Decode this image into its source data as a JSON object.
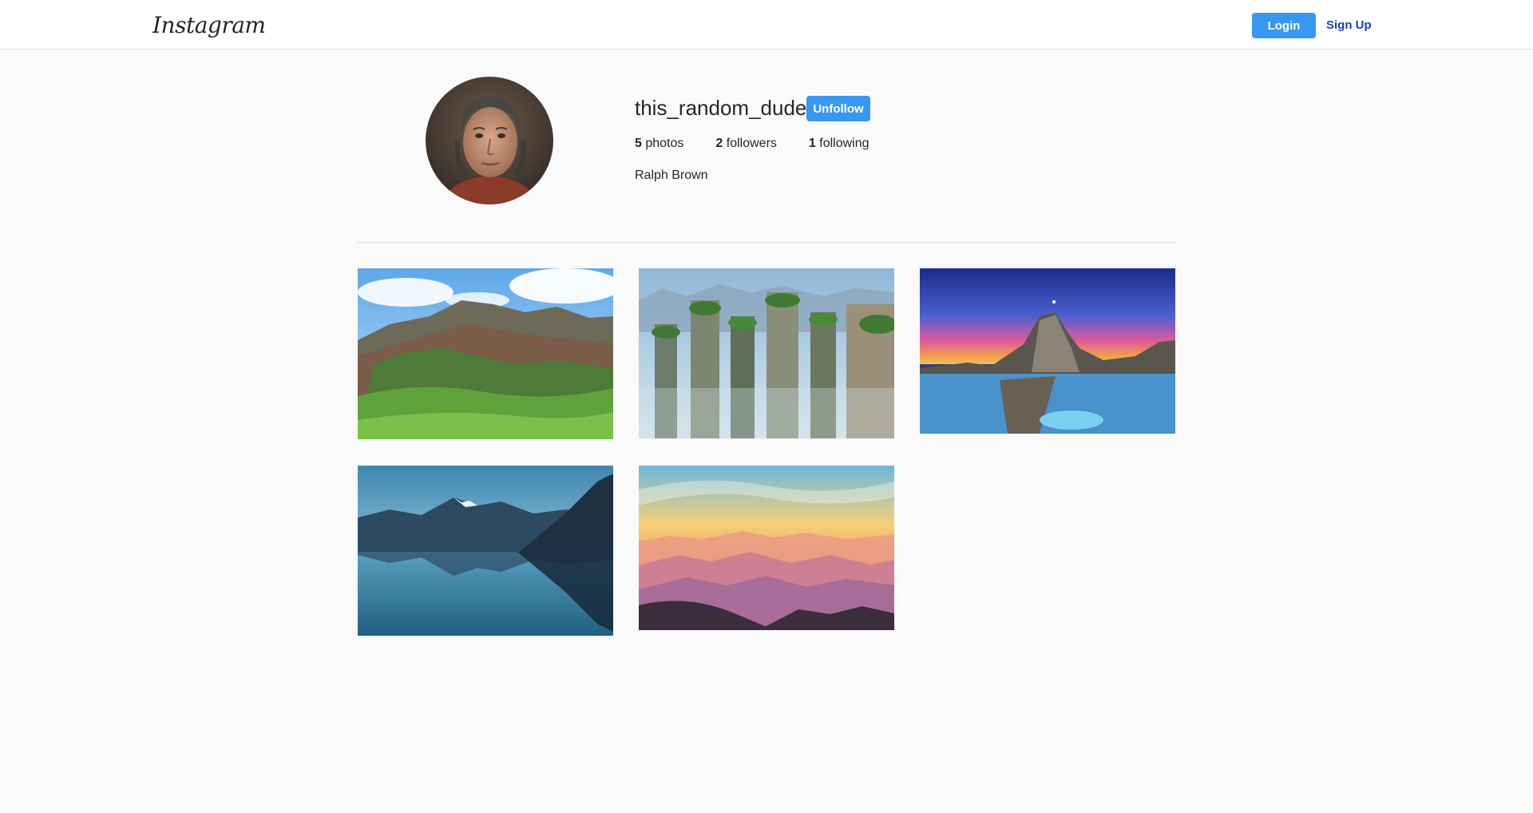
{
  "header": {
    "logo_text": "Instagram",
    "login_label": "Login",
    "signup_label": "Sign Up"
  },
  "profile": {
    "username": "this_random_dude",
    "follow_button_label": "Unfollow",
    "stats": [
      {
        "count": "5",
        "label": "photos"
      },
      {
        "count": "2",
        "label": "followers"
      },
      {
        "count": "1",
        "label": "following"
      }
    ],
    "full_name": "Ralph Brown"
  },
  "colors": {
    "accent": "#3897f0",
    "link": "#1e3fb3",
    "background": "#fafafa"
  }
}
